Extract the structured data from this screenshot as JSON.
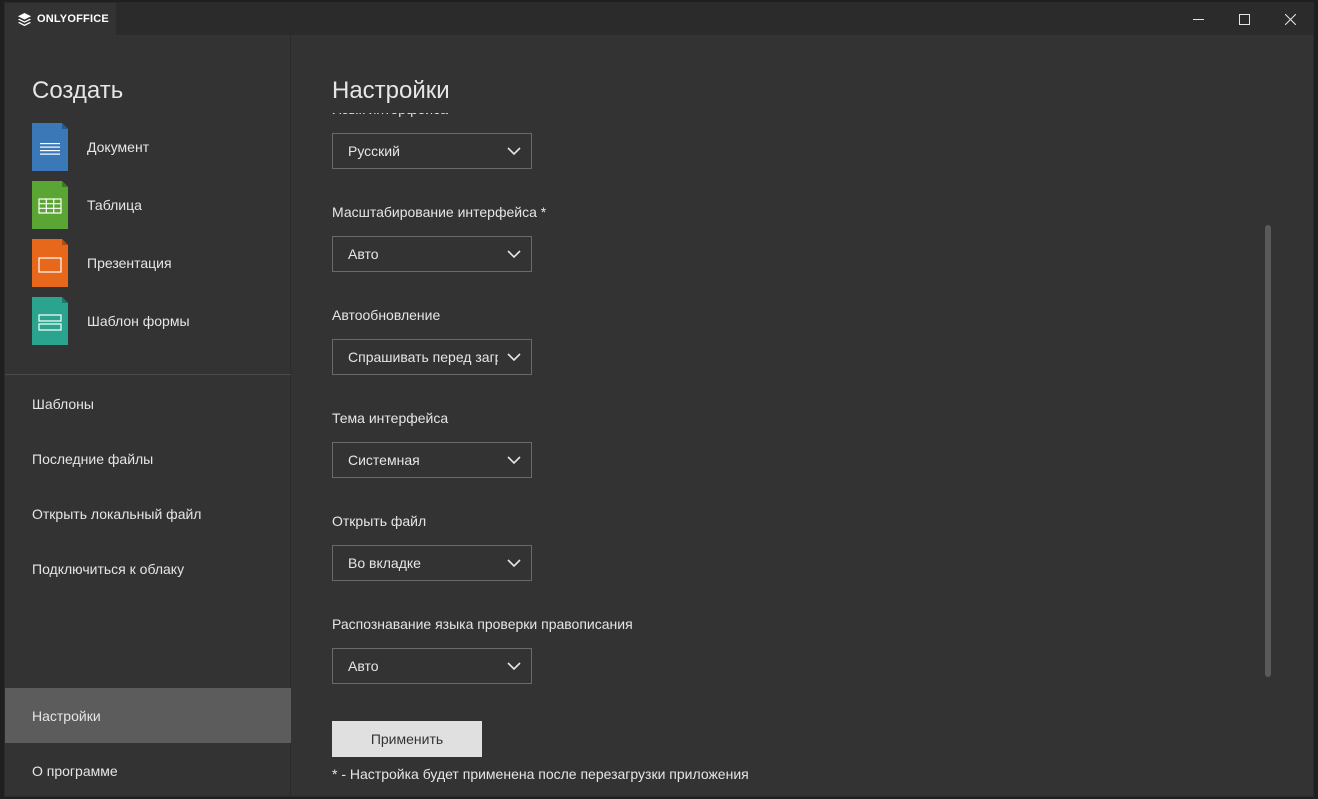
{
  "titlebar": {
    "app_name": "ONLYOFFICE"
  },
  "sidebar": {
    "create_title": "Создать",
    "create_items": [
      {
        "label": "Документ",
        "icon": "document-icon",
        "color": "#3a78b8"
      },
      {
        "label": "Таблица",
        "icon": "spreadsheet-icon",
        "color": "#5ba534"
      },
      {
        "label": "Презентация",
        "icon": "presentation-icon",
        "color": "#e8681b"
      },
      {
        "label": "Шаблон формы",
        "icon": "form-template-icon",
        "color": "#2aa38f"
      }
    ],
    "nav_items": [
      {
        "label": "Шаблоны"
      },
      {
        "label": "Последние файлы"
      },
      {
        "label": "Открыть локальный файл"
      },
      {
        "label": "Подключиться к облаку"
      },
      {
        "label": "Настройки",
        "active": true
      },
      {
        "label": "О программе"
      }
    ]
  },
  "main": {
    "title": "Настройки",
    "settings": [
      {
        "label": "Язык интерфейса",
        "value": "Русский"
      },
      {
        "label": "Масштабирование интерфейса *",
        "value": "Авто"
      },
      {
        "label": "Автообновление",
        "value": "Спрашивать перед загрузкой"
      },
      {
        "label": "Тема интерфейса",
        "value": "Системная"
      },
      {
        "label": "Открыть файл",
        "value": "Во вкладке"
      },
      {
        "label": "Распознавание языка проверки правописания",
        "value": "Авто"
      }
    ],
    "apply_label": "Применить",
    "footnote": "* - Настройка будет применена после перезагрузки приложения"
  },
  "colors": {
    "background": "#333333",
    "active_nav": "#5c5c5c",
    "apply_button": "#e0e0e0"
  }
}
